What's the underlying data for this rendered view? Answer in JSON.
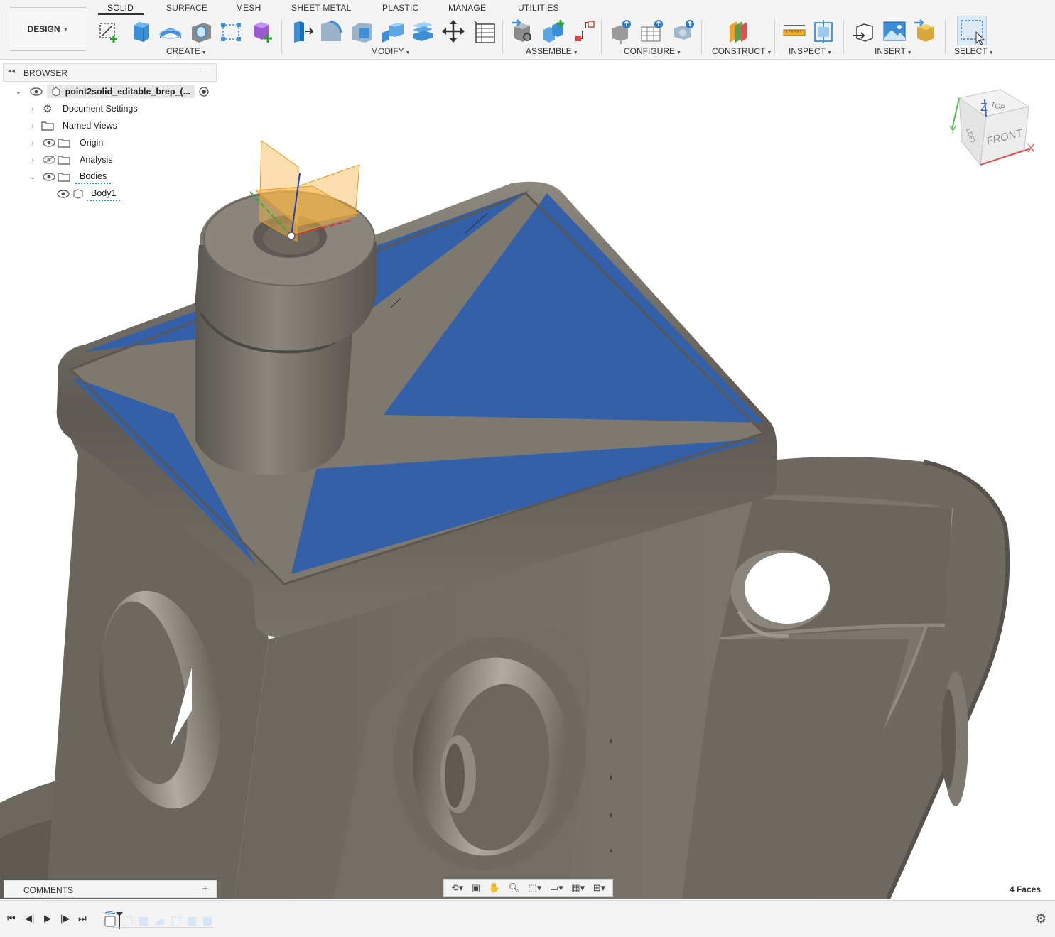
{
  "workspace": {
    "label": "DESIGN"
  },
  "tabs": [
    {
      "label": "SOLID",
      "active": true
    },
    {
      "label": "SURFACE"
    },
    {
      "label": "MESH"
    },
    {
      "label": "SHEET METAL"
    },
    {
      "label": "PLASTIC"
    },
    {
      "label": "MANAGE"
    },
    {
      "label": "UTILITIES"
    }
  ],
  "groups": {
    "create": "CREATE",
    "modify": "MODIFY",
    "assemble": "ASSEMBLE",
    "configure": "CONFIGURE",
    "construct": "CONSTRUCT",
    "inspect": "INSPECT",
    "insert": "INSERT",
    "select": "SELECT"
  },
  "browser": {
    "title": "BROWSER",
    "root": "point2solid_editable_brep_(...",
    "items": [
      {
        "label": "Document Settings"
      },
      {
        "label": "Named Views"
      },
      {
        "label": "Origin"
      },
      {
        "label": "Analysis"
      },
      {
        "label": "Bodies"
      },
      {
        "label": "Body1"
      }
    ]
  },
  "comments": {
    "title": "COMMENTS"
  },
  "status": {
    "selection": "4 Faces"
  },
  "viewcube": {
    "top": "TOP",
    "left": "LEFT",
    "front": "FRONT",
    "x": "X",
    "y": "Y",
    "z": "Z"
  },
  "colors": {
    "model": "#6f6b62",
    "selected_face": "#3360a9",
    "plane": "#f6b64a",
    "axis_x": "#e03030",
    "axis_y": "#30b030",
    "axis_z": "#2040d0"
  }
}
